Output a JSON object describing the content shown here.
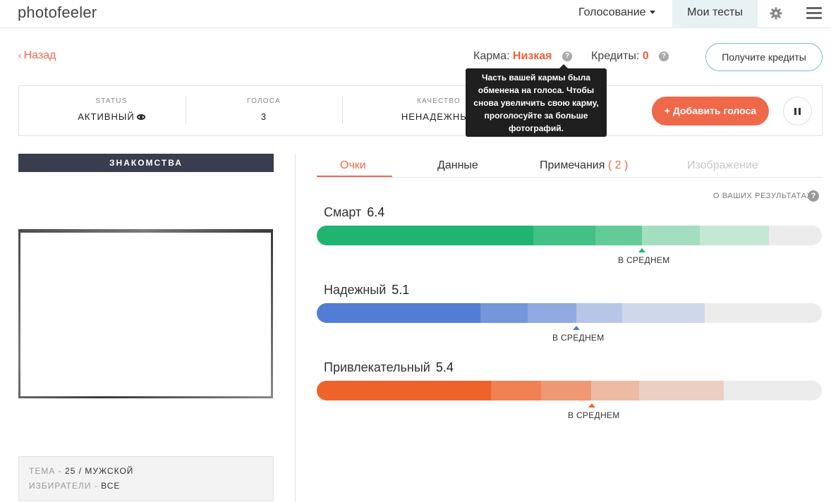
{
  "nav": {
    "logo": "photofeeler",
    "vote": "Голосование",
    "my_tests": "Мои тесты",
    "settings_icon": "gear-icon",
    "menu_icon": "hamburger-icon"
  },
  "subheader": {
    "back": "Назад",
    "karma_label": "Карма:",
    "karma_value": "Низкая",
    "credits_label": "Кредиты:",
    "credits_value": "0",
    "help_glyph": "?",
    "get_credits": "Получите кредиты"
  },
  "tooltip": {
    "text": "Часть вашей кармы была обменена на голоса. Чтобы снова увеличить свою карму, проголосуйте за больше фотографий."
  },
  "status_panel": {
    "status_label": "STATUS",
    "status_value": "АКТИВНЫЙ",
    "votes_label": "ГОЛОСА",
    "votes_value": "3",
    "quality_label": "КАЧЕСТВО",
    "quality_value": "НЕНАДЕЖНЫЙ",
    "add_votes": "+ Добавить голоса"
  },
  "left": {
    "category": "ЗНАКОМСТВА",
    "subject_label": "ТЕМА",
    "subject_value": "25 / МУЖСКОЙ",
    "voters_label": "ИЗБИРАТЕЛИ",
    "voters_value": "ВСЕ",
    "sep": " - "
  },
  "tabs": {
    "scores": "Очки",
    "data": "Данные",
    "notes": "Примечания",
    "notes_count": "( 2 )",
    "image": "Изображение"
  },
  "results": {
    "about": "О ВАШИХ РЕЗУЛЬТАТАХ",
    "avg_label": "В СРЕДНЕМ",
    "scores": [
      {
        "name": "Смарт",
        "value": "6.4",
        "fraction": 0.64,
        "color": "#1fb571"
      },
      {
        "name": "Надежный",
        "value": "5.1",
        "fraction": 0.51,
        "color": "#517ed4"
      },
      {
        "name": "Привлекательный",
        "value": "5.4",
        "fraction": 0.54,
        "color": "#ee6329"
      }
    ]
  },
  "colors": {
    "accent": "#f06a4a",
    "category_bar": "#393d4d",
    "tooltip": "#1f1f1f"
  }
}
